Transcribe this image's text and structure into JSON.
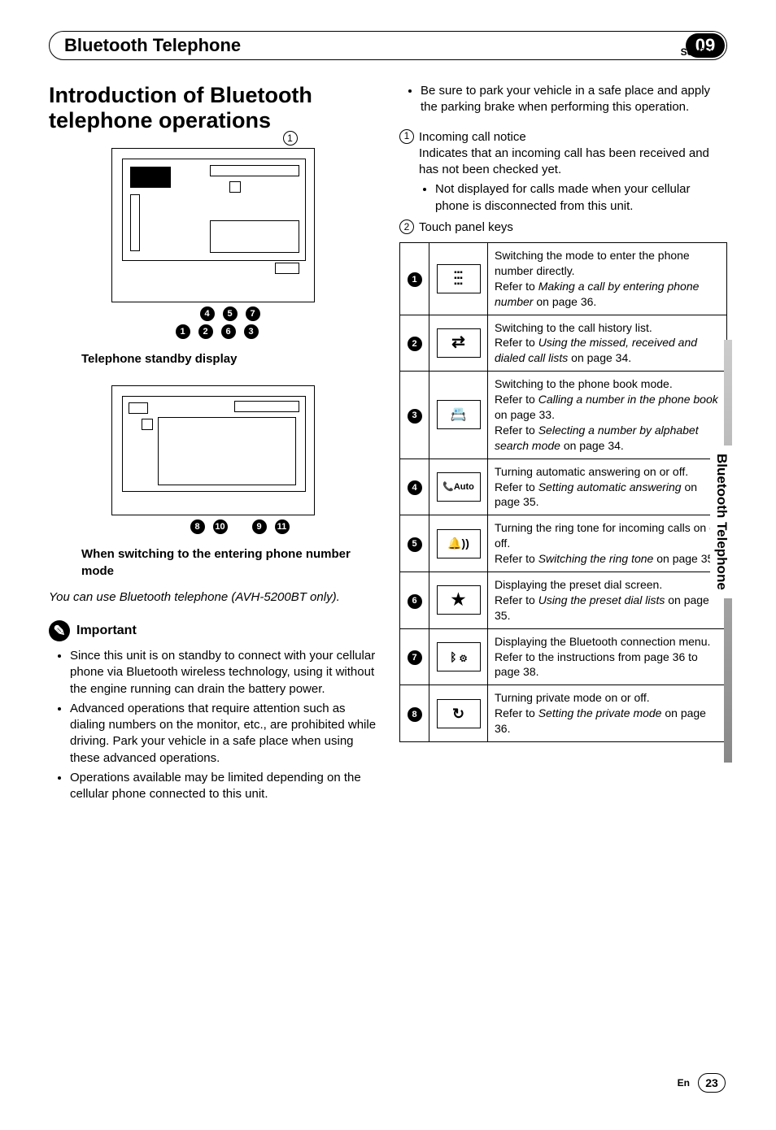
{
  "section_label": "Section",
  "section_number": "09",
  "header_title": "Bluetooth Telephone",
  "side_tab": "Bluetooth Telephone",
  "page_lang": "En",
  "page_number": "23",
  "left": {
    "heading": "Introduction of Bluetooth telephone operations",
    "caption1": "Telephone standby display",
    "caption2": "When switching to the entering phone number mode",
    "note": "You can use Bluetooth telephone (AVH-5200BT only).",
    "important_label": "Important",
    "bullets": [
      "Since this unit is on standby to connect with your cellular phone via Bluetooth wireless technology, using it without the engine running can drain the battery power.",
      "Advanced operations that require attention such as dialing numbers on the monitor, etc., are prohibited while driving. Park your vehicle in a safe place when using these advanced operations.",
      "Operations available may be limited depending on the cellular phone connected to this unit."
    ]
  },
  "right": {
    "top_bullet": "Be sure to park your vehicle in a safe place and apply the parking brake when performing this operation.",
    "item1_title": "Incoming call notice",
    "item1_body": "Indicates that an incoming call has been received and has not been checked yet.",
    "item1_sub": "Not displayed for calls made when your cellular phone is disconnected from this unit.",
    "item2_title": "Touch panel keys",
    "table": [
      {
        "n": "1",
        "icon": "keypad",
        "text": "Switching the mode to enter the phone number directly.",
        "ref": "Refer to ",
        "em": "Making a call by entering phone number",
        "tail": " on page 36."
      },
      {
        "n": "2",
        "icon": "history",
        "text": "Switching to the call history list.",
        "ref": "Refer to ",
        "em": "Using the missed, received and dialed call lists",
        "tail": " on page 34."
      },
      {
        "n": "3",
        "icon": "phonebook",
        "text": "Switching to the phone book mode.",
        "ref": "Refer to ",
        "em": "Calling a number in the phone book",
        "tail": " on page 33.",
        "ref2": "Refer to ",
        "em2": "Selecting a number by alphabet search mode",
        "tail2": " on page 34."
      },
      {
        "n": "4",
        "icon": "auto",
        "text": "Turning automatic answering on or off.",
        "ref": "Refer to ",
        "em": "Setting automatic answering",
        "tail": " on page 35."
      },
      {
        "n": "5",
        "icon": "ringer",
        "text": "Turning the ring tone for incoming calls on or off.",
        "ref": "Refer to ",
        "em": "Switching the ring tone",
        "tail": " on page 35."
      },
      {
        "n": "6",
        "icon": "star",
        "text": "Displaying the preset dial screen.",
        "ref": "Refer to ",
        "em": "Using the preset dial lists",
        "tail": " on page 35."
      },
      {
        "n": "7",
        "icon": "bt-menu",
        "text": "Displaying the Bluetooth connection menu.",
        "ref": "Refer to the instructions from page 36 to page 38.",
        "em": "",
        "tail": ""
      },
      {
        "n": "8",
        "icon": "private",
        "text": "Turning private mode on or off.",
        "ref": "Refer to ",
        "em": "Setting the private mode",
        "tail": " on page 36."
      }
    ]
  },
  "icons": {
    "keypad": "⋮⋮⋮",
    "history": "⇄",
    "phonebook": "📕",
    "auto": "Auto",
    "ringer": "🔔))",
    "star": "★",
    "bt-menu": "ᛒ ⚙",
    "private": "↻"
  }
}
